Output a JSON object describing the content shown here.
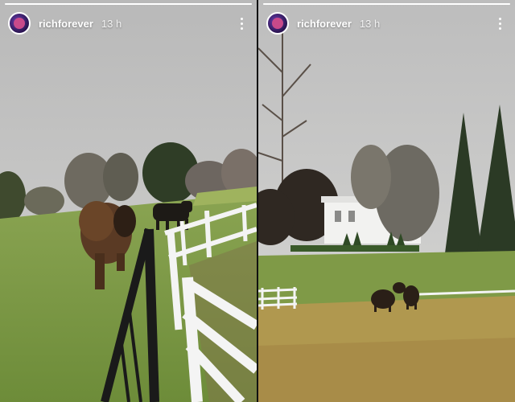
{
  "stories": [
    {
      "username": "richforever",
      "time": "13 h",
      "avatar_icon": "profile-avatar-icon",
      "more_icon": "more-vertical-icon",
      "progress": 1.0
    },
    {
      "username": "richforever",
      "time": "13 h",
      "avatar_icon": "profile-avatar-icon",
      "more_icon": "more-vertical-icon",
      "progress": 1.0
    }
  ],
  "colors": {
    "sky": "#c9c9c9",
    "grass": "#7c9a45",
    "dry_grass": "#b59b55",
    "fence": "#f4f4f4",
    "bison": "#4a3222"
  }
}
